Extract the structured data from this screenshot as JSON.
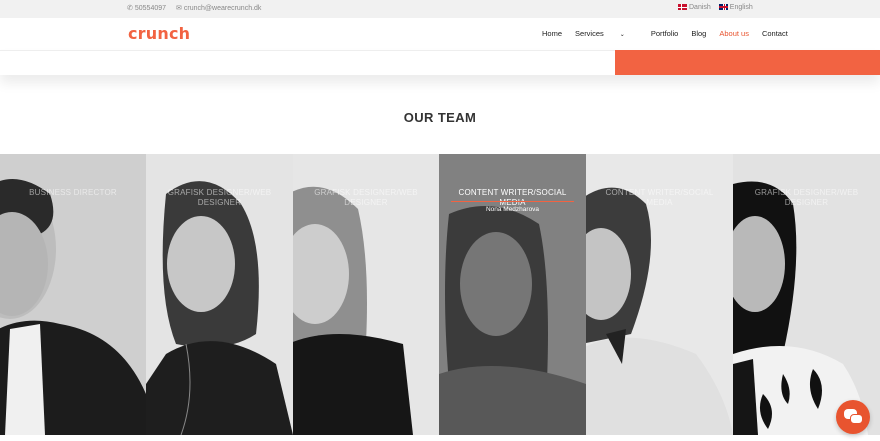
{
  "topbar": {
    "phone": "50554097",
    "email": "crunch@wearecrunch.dk",
    "languages": [
      "Danish",
      "English"
    ]
  },
  "header": {
    "logo": "crunch",
    "nav": [
      "Home",
      "Services",
      "Portfolio",
      "Blog",
      "About us",
      "Contact"
    ],
    "active_nav": "About us"
  },
  "section": {
    "title": "OUR TEAM"
  },
  "team": [
    {
      "role": "BUSINESS DIRECTOR",
      "name": ""
    },
    {
      "role": "GRAFISK DESIGNER/WEB DESIGNER",
      "name": ""
    },
    {
      "role": "GRAFISK DESIGNER/WEB DESIGNER",
      "name": ""
    },
    {
      "role": "CONTENT WRITER/SOCIAL MEDIA",
      "name": "Nona Medzharova"
    },
    {
      "role": "CONTENT WRITER/SOCIAL MEDIA",
      "name": ""
    },
    {
      "role": "GRAFISK DESIGNER/WEB DESIGNER",
      "name": ""
    }
  ],
  "colors": {
    "accent": "#f26342",
    "nav_active": "#e8542f"
  },
  "icons": {
    "phone": "phone-icon",
    "email": "email-icon",
    "chat": "chat-icon"
  }
}
